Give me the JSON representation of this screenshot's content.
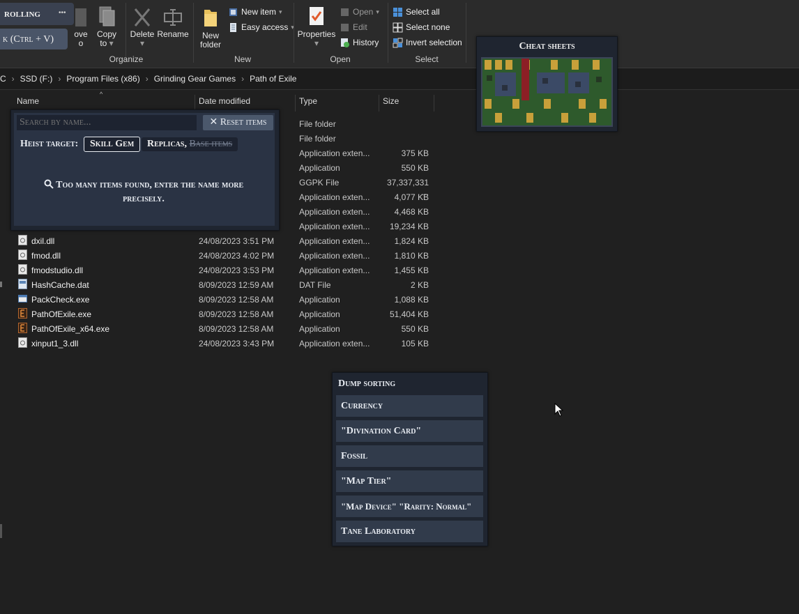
{
  "ribbon": {
    "overlay_title": "rolling",
    "overlay_dots": "•••",
    "overlay_paste": "k (Ctrl + V)",
    "move_label_1": "ove",
    "move_label_2": "o",
    "copy_label_1": "Copy",
    "copy_label_2": "to",
    "delete_label": "Delete",
    "rename_label": "Rename",
    "organize_group": "Organize",
    "newfolder_label_1": "New",
    "newfolder_label_2": "folder",
    "new_item": "New item",
    "easy_access": "Easy access",
    "new_group": "New",
    "properties_label": "Properties",
    "open_label": "Open",
    "edit_label": "Edit",
    "history_label": "History",
    "open_group": "Open",
    "select_all": "Select all",
    "select_none": "Select none",
    "invert_selection": "Invert selection",
    "select_group": "Select"
  },
  "breadcrumb": [
    "C",
    "SSD (F:)",
    "Program Files (x86)",
    "Grinding Gear Games",
    "Path of Exile"
  ],
  "columns": {
    "name": "Name",
    "date": "Date modified",
    "type": "Type",
    "size": "Size"
  },
  "hidden_rows": [
    {
      "type": "File folder",
      "size": ""
    },
    {
      "type": "File folder",
      "size": ""
    },
    {
      "type": "Application exten...",
      "size": "375 KB"
    },
    {
      "type": "Application",
      "size": "550 KB"
    },
    {
      "type": "GGPK File",
      "size": "37,337,331 ..."
    },
    {
      "type": "Application exten...",
      "size": "4,077 KB"
    },
    {
      "type": "Application exten...",
      "size": "4,468 KB"
    },
    {
      "type": "Application exten...",
      "size": "19,234 KB"
    }
  ],
  "files": [
    {
      "name": "dxil.dll",
      "date": "24/08/2023 3:51 PM",
      "type": "Application exten...",
      "size": "1,824 KB",
      "icon": "dll-icon"
    },
    {
      "name": "fmod.dll",
      "date": "24/08/2023 4:02 PM",
      "type": "Application exten...",
      "size": "1,810 KB",
      "icon": "dll-icon"
    },
    {
      "name": "fmodstudio.dll",
      "date": "24/08/2023 3:53 PM",
      "type": "Application exten...",
      "size": "1,455 KB",
      "icon": "dll-icon"
    },
    {
      "name": "HashCache.dat",
      "date": "8/09/2023 12:59 AM",
      "type": "DAT File",
      "size": "2 KB",
      "icon": "dat-icon"
    },
    {
      "name": "PackCheck.exe",
      "date": "8/09/2023 12:58 AM",
      "type": "Application",
      "size": "1,088 KB",
      "icon": "exe-icon"
    },
    {
      "name": "PathOfExile.exe",
      "date": "8/09/2023 12:58 AM",
      "type": "Application",
      "size": "51,404 KB",
      "icon": "poe-icon"
    },
    {
      "name": "PathOfExile_x64.exe",
      "date": "8/09/2023 12:58 AM",
      "type": "Application",
      "size": "550 KB",
      "icon": "poe-icon"
    },
    {
      "name": "xinput1_3.dll",
      "date": "24/08/2023 3:43 PM",
      "type": "Application exten...",
      "size": "105 KB",
      "icon": "dll-icon"
    }
  ],
  "search_panel": {
    "placeholder": "Search by name...",
    "reset_label": "Reset items",
    "heist_label": "Heist target:",
    "chip_skill_gem": "Skill Gem",
    "chip_replicas": "Replicas,",
    "chip_base_items": "Base items",
    "message": "Too many items found, enter the name more precisely."
  },
  "cheat_sheets": {
    "title": "Cheat sheets"
  },
  "dump_sorting": {
    "title": "Dump sorting",
    "items": [
      "Currency",
      "\"Divination Card\"",
      "Fossil",
      "\"Map Tier\"",
      "\"Map Device\" \"Rarity: Normal\"",
      "Tane Laboratory"
    ]
  },
  "colors": {
    "panel_bg": "#1f2530",
    "button_bg": "#313b4b",
    "explorer_bg": "#202020"
  }
}
